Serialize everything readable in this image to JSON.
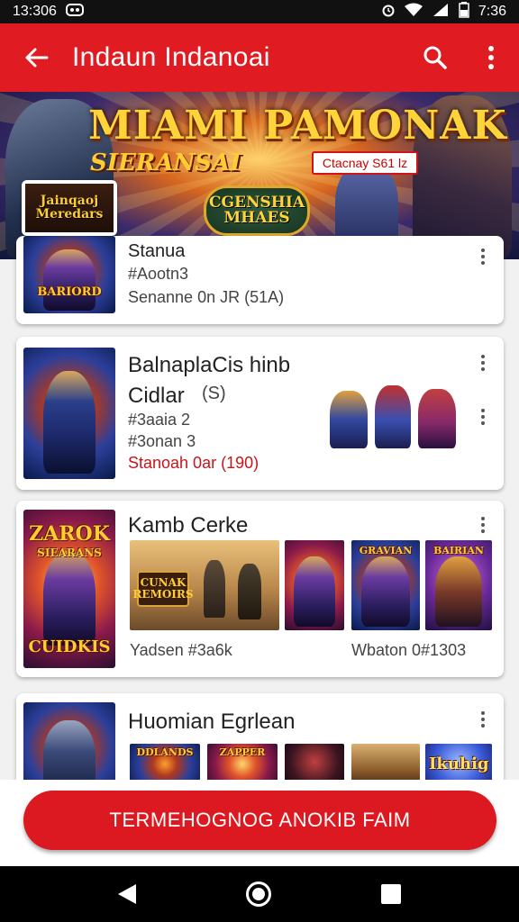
{
  "status_bar": {
    "time_left": "13:306",
    "time_right": "7:36"
  },
  "app_bar": {
    "title": "Indaun Indanoai"
  },
  "banner": {
    "title": "MIAMI PAMONAK",
    "subtitle": "SIERANSAI",
    "pill": "Ctacnay S61 lz",
    "badge_line1": "CGENSHIA",
    "badge_line2": "MHAES"
  },
  "float_tile": {
    "line1": "Jainqaoj",
    "line2": "Meredars"
  },
  "cards": [
    {
      "title": "Stanua",
      "meta1": "#Aootn3",
      "meta2": "Senanne 0n JR (51A)",
      "thumb_title": "BARIORD",
      "thumb_style": "art-blue"
    },
    {
      "title_line1": "BalnaplaCis hinb",
      "title_line2": "Cidlar",
      "title_icon": "(S)",
      "meta1": "#3aaia 2",
      "meta2": "#3onan 3",
      "meta3": "Stanoah 0ar (190)"
    },
    {
      "title": "Kamb Cerke",
      "thumb_title_top": "ZAROK",
      "thumb_title_top2": "SIEARANS",
      "thumb_title_bottom": "CUIDKIS",
      "mini_banner_title": "CUNAK",
      "mini_banner_sub": "REMOIRS",
      "mini3_title": "GRAVIAN",
      "mini4_title": "BAIRIAN",
      "footer_left": "Yadsen #3a6k",
      "footer_right": "Wbaton 0#1303"
    },
    {
      "title": "Huomian Egrlean",
      "mini_titles": [
        "DDLANDS",
        "ZAPPER",
        "",
        "",
        "Ikuhig"
      ]
    }
  ],
  "cta": {
    "label": "TERMEHOGNOG ANOKIB FAIM"
  },
  "colors": {
    "brand_red": "#e11b22",
    "cta_red": "#dc1820",
    "nav_bg": "#000000"
  },
  "icons": [
    "back-arrow-icon",
    "search-icon",
    "more-vert-icon",
    "nav-back-icon",
    "nav-home-icon",
    "nav-recent-icon"
  ]
}
